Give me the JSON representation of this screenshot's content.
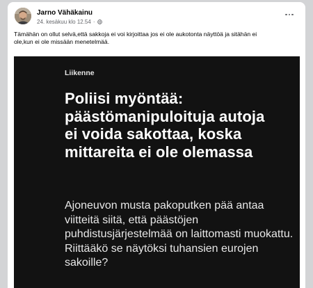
{
  "post": {
    "author": "Jarno Vähäkainu",
    "timestamp": "24. kesäkuu klo 12.54",
    "separator": "·",
    "privacy_icon": "globe-icon",
    "more_icon": "more-options-icon",
    "text_line1": "Tämähän on ollut selvä,että sakkoja ei voi kirjoittaa jos ei ole aukotonta näyttöä ja sitähän ei",
    "text_line2": "ole,kun ei ole missään menetelmää."
  },
  "article": {
    "category": "Liikenne",
    "headline": "Poliisi myöntää: päästömanipuloituja autoja ei voida sakottaa, koska mittareita ei ole olemassa",
    "lead": "Ajoneuvon musta pakoputken pää antaa viitteitä siitä, että päästöjen puhdistusjärjestelmää on laittomasti muokattu. Riittääkö se näytöksi tuhansien eurojen sakoille?"
  },
  "colors": {
    "page_background": "#d3d4d6",
    "card_background": "#ffffff",
    "article_background": "#121212",
    "secondary_text": "#65676b"
  }
}
